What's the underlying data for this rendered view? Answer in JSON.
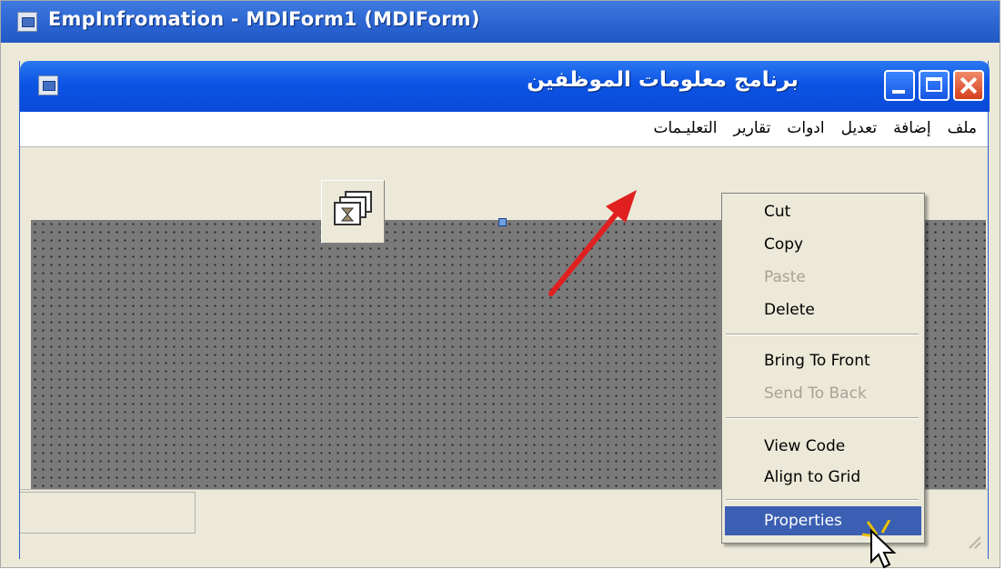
{
  "outer_window": {
    "title": "EmpInfromation - MDIForm1 (MDIForm)"
  },
  "mdi_form": {
    "title": "برنامج معلومات  الموظفين",
    "menu": [
      "ملف",
      "إضافة",
      "تعديل",
      "ادوات",
      "تقارير",
      "التعليـمات"
    ]
  },
  "context_menu": {
    "items": [
      {
        "label": "Cut",
        "enabled": true
      },
      {
        "label": "Copy",
        "enabled": true
      },
      {
        "label": "Paste",
        "enabled": false
      },
      {
        "label": "Delete",
        "enabled": true
      },
      {
        "label": "Bring To Front",
        "enabled": true
      },
      {
        "label": "Send To Back",
        "enabled": false
      },
      {
        "label": "View Code",
        "enabled": true
      },
      {
        "label": "Align to Grid",
        "enabled": true
      },
      {
        "label": "Properties",
        "enabled": true,
        "highlighted": true
      }
    ]
  },
  "colors": {
    "accent": "#3b5fb3",
    "titlebar": "#0c54e4",
    "annotation_arrow": "#e02020"
  },
  "icons": [
    "app-icon",
    "minimize-icon",
    "maximize-icon",
    "close-icon",
    "imagelist-icon",
    "mouse-pointer-icon"
  ]
}
